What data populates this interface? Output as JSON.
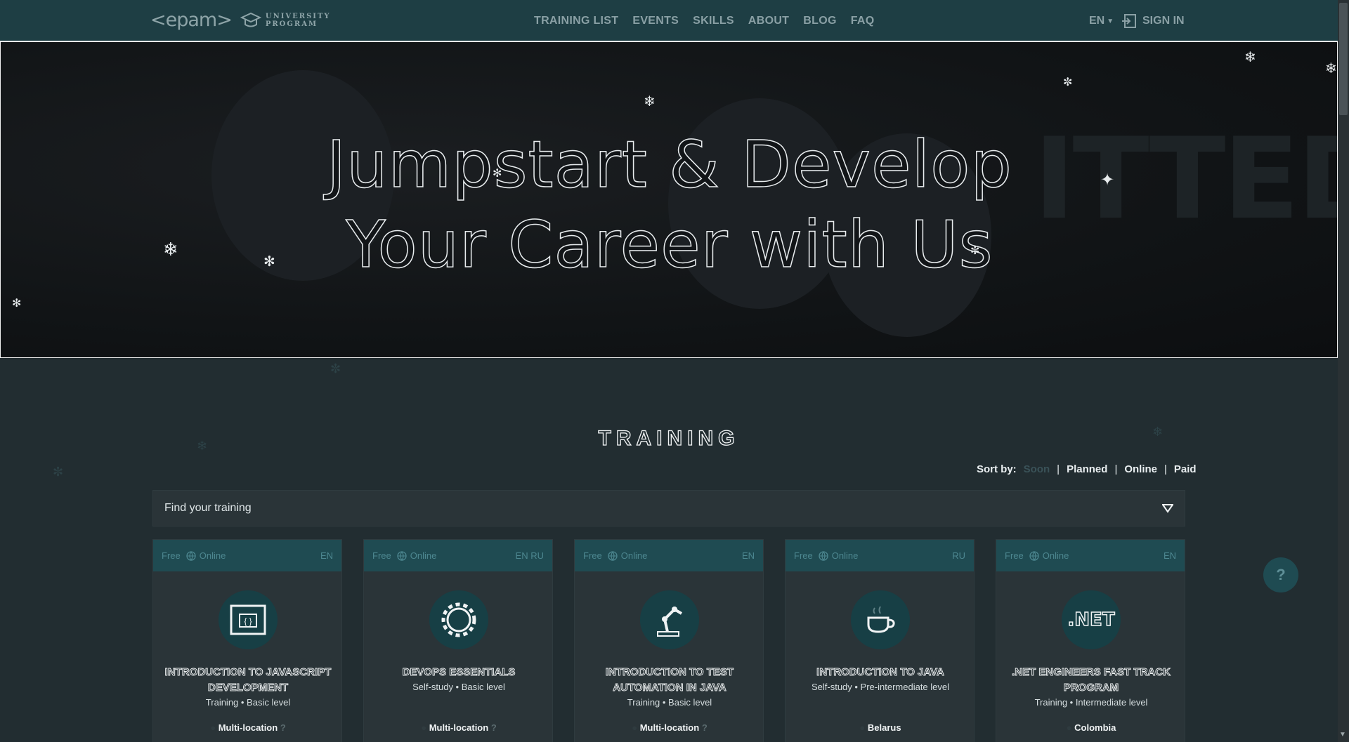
{
  "header": {
    "logo_text": "<epam>",
    "logo_sub": "UNIVERSITY PROGRAM",
    "nav": [
      "TRAINING LIST",
      "EVENTS",
      "SKILLS",
      "ABOUT",
      "BLOG",
      "FAQ"
    ],
    "lang": "EN",
    "signin": "SIGN IN"
  },
  "hero": {
    "line1": "Jumpstart & Develop",
    "line2": "Your Career with Us",
    "bg_letters": "ITTED"
  },
  "training": {
    "title": "TRAINING",
    "sort_label": "Sort by:",
    "sort_options": [
      "Soon",
      "Planned",
      "Online",
      "Paid"
    ],
    "search_placeholder": "Find your training"
  },
  "cards": [
    {
      "price": "Free",
      "mode": "Online",
      "langs": "EN",
      "icon": "js-window-icon",
      "title": "INTRODUCTION TO JAVASCRIPT DEVELOPMENT",
      "subtitle": "Training • Basic level",
      "location": "Multi-location"
    },
    {
      "price": "Free",
      "mode": "Online",
      "langs": "EN RU",
      "icon": "gear-icon",
      "title": "DEVOPS ESSENTIALS",
      "subtitle": "Self-study • Basic level",
      "location": "Multi-location"
    },
    {
      "price": "Free",
      "mode": "Online",
      "langs": "EN",
      "icon": "robot-arm-icon",
      "title": "INTRODUCTION TO TEST AUTOMATION IN JAVA",
      "subtitle": "Training • Basic level",
      "location": "Multi-location"
    },
    {
      "price": "Free",
      "mode": "Online",
      "langs": "RU",
      "icon": "coffee-cup-icon",
      "title": "INTRODUCTION TO JAVA",
      "subtitle": "Self-study • Pre-intermediate level",
      "location": "Belarus"
    },
    {
      "price": "Free",
      "mode": "Online",
      "langs": "EN",
      "icon": "dotnet-icon",
      "title": ".NET ENGINEERS FAST TRACK PROGRAM",
      "subtitle": "Training • Intermediate level",
      "location": "Colombia"
    }
  ],
  "help": "?",
  "colors": {
    "accent": "#1f4b52",
    "header_bg": "#1e3e44",
    "page_bg": "#222d31"
  }
}
